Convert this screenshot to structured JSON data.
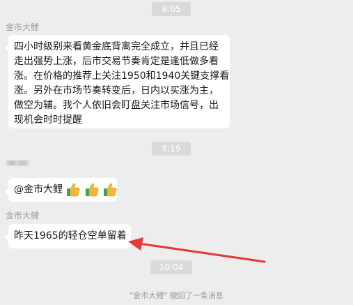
{
  "timestamps": {
    "first": "8:05",
    "second": "8:19",
    "third": "10:04"
  },
  "messages": {
    "first": {
      "sender": "金市大鲤",
      "lines": [
        "四小时级别来看黄金底背离完全成立，并且已经",
        "走出强势上涨，后市交易节奏肯定是逢低做多看",
        "涨。在价格的推荐上关注1950和1940关键支撑看",
        "涨。另外在市场节奏转变后，日内以买涨为主，",
        "做空为辅。我个人依旧会盯盘关注市场信号，出",
        "现机会时时提醒"
      ]
    },
    "second": {
      "mention": "@金市大鲤",
      "icons": [
        "thumbs-up-icon",
        "thumbs-up-icon",
        "thumbs-up-icon"
      ]
    },
    "third": {
      "sender": "金市大鲤",
      "text": "昨天1965的轻仓空单留着"
    }
  },
  "recall_notice": "\"金市大鲤\" 撤回了一条消息",
  "colors": {
    "background": "#ededed",
    "bubble": "#ffffff",
    "time_pill": "#dadada",
    "arrow": "#e53935",
    "thumb": "#f2b63a",
    "cuff": "#3aa35b"
  }
}
